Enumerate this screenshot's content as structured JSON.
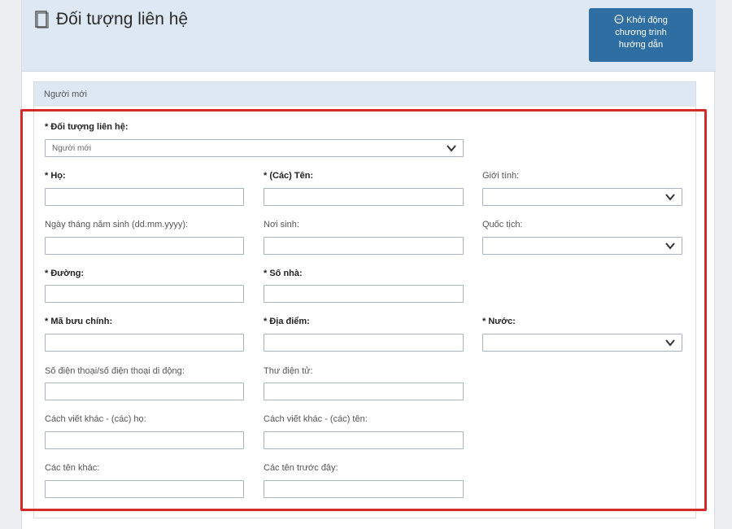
{
  "header": {
    "title": "Đối tượng liên hệ",
    "guide_button": [
      "Khởi động",
      "chương trình",
      "hướng dẫn"
    ]
  },
  "section": {
    "title": "Người mới"
  },
  "form": {
    "contact_type": {
      "label": "* Đối tượng liên hệ:",
      "value": "Người mới"
    },
    "last_name": {
      "label": "* Họ:"
    },
    "first_name": {
      "label": "* (Các) Tên:"
    },
    "gender": {
      "label": "Giới tính:"
    },
    "birth_date": {
      "label": "Ngày tháng năm sinh (dd.mm.yyyy):"
    },
    "birth_place": {
      "label": "Nơi sinh:"
    },
    "nationality": {
      "label": "Quốc tịch:"
    },
    "street": {
      "label": "* Đường:"
    },
    "house_number": {
      "label": "* Số nhà:"
    },
    "postal_code": {
      "label": "* Mã bưu chính:"
    },
    "location": {
      "label": "* Địa điểm:"
    },
    "country": {
      "label": "* Nước:"
    },
    "phone": {
      "label": "Số điện thoại/số điện thoại di động:"
    },
    "email": {
      "label": "Thư điện tử:"
    },
    "alt_last_name": {
      "label": "Cách viết khác - (các) họ:"
    },
    "alt_first_name": {
      "label": "Cách viết khác - (các) tên:"
    },
    "other_names": {
      "label": "Các tên khác:"
    },
    "former_names": {
      "label": "Các tên trước đây:"
    }
  },
  "colors": {
    "header_bg": "#dde8f2",
    "button_bg": "#2f6ea2",
    "highlight": "#d42a2a"
  }
}
